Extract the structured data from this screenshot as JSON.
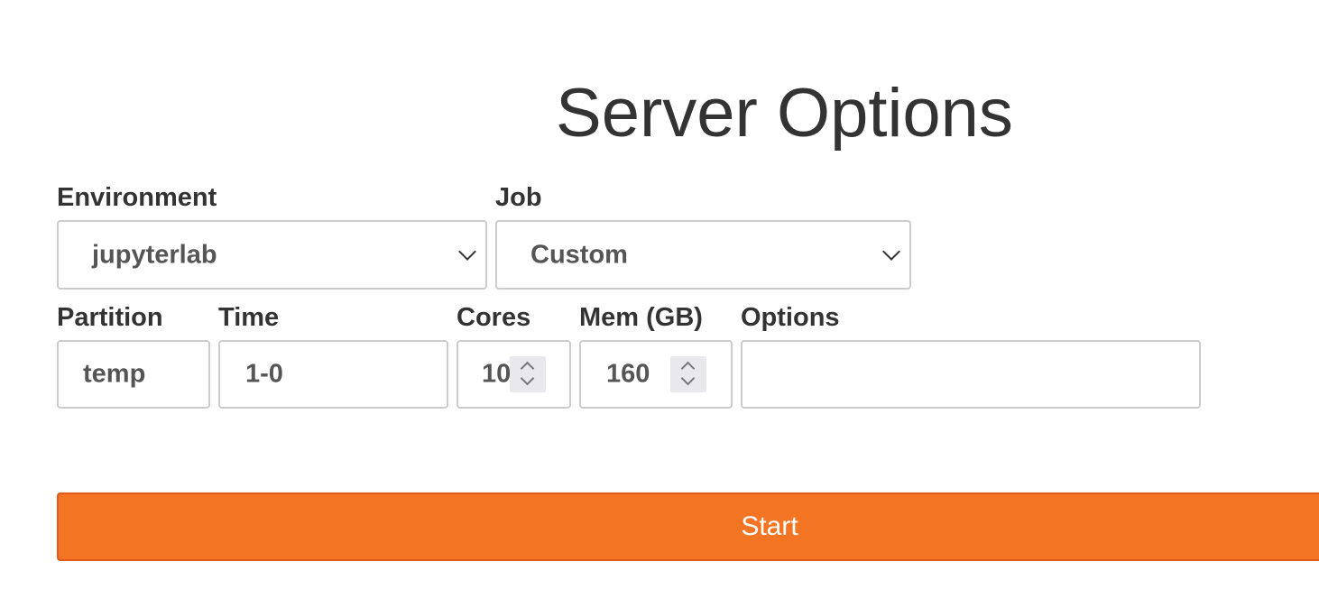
{
  "header": {
    "title": "Server Options"
  },
  "form": {
    "environment": {
      "label": "Environment",
      "value": "jupyterlab"
    },
    "job": {
      "label": "Job",
      "value": "Custom"
    },
    "partition": {
      "label": "Partition",
      "value": "temp"
    },
    "time": {
      "label": "Time",
      "value": "1-0"
    },
    "cores": {
      "label": "Cores",
      "value": "10"
    },
    "mem": {
      "label": "Mem (GB)",
      "value": "160"
    },
    "options": {
      "label": "Options",
      "value": ""
    }
  },
  "actions": {
    "start_label": "Start"
  },
  "colors": {
    "accent": "#f37524",
    "accent_border": "#e2571e",
    "text": "#333333",
    "border": "#cccccc"
  },
  "icons": [
    "chevron-down-icon",
    "spinner-up-icon",
    "spinner-down-icon"
  ]
}
